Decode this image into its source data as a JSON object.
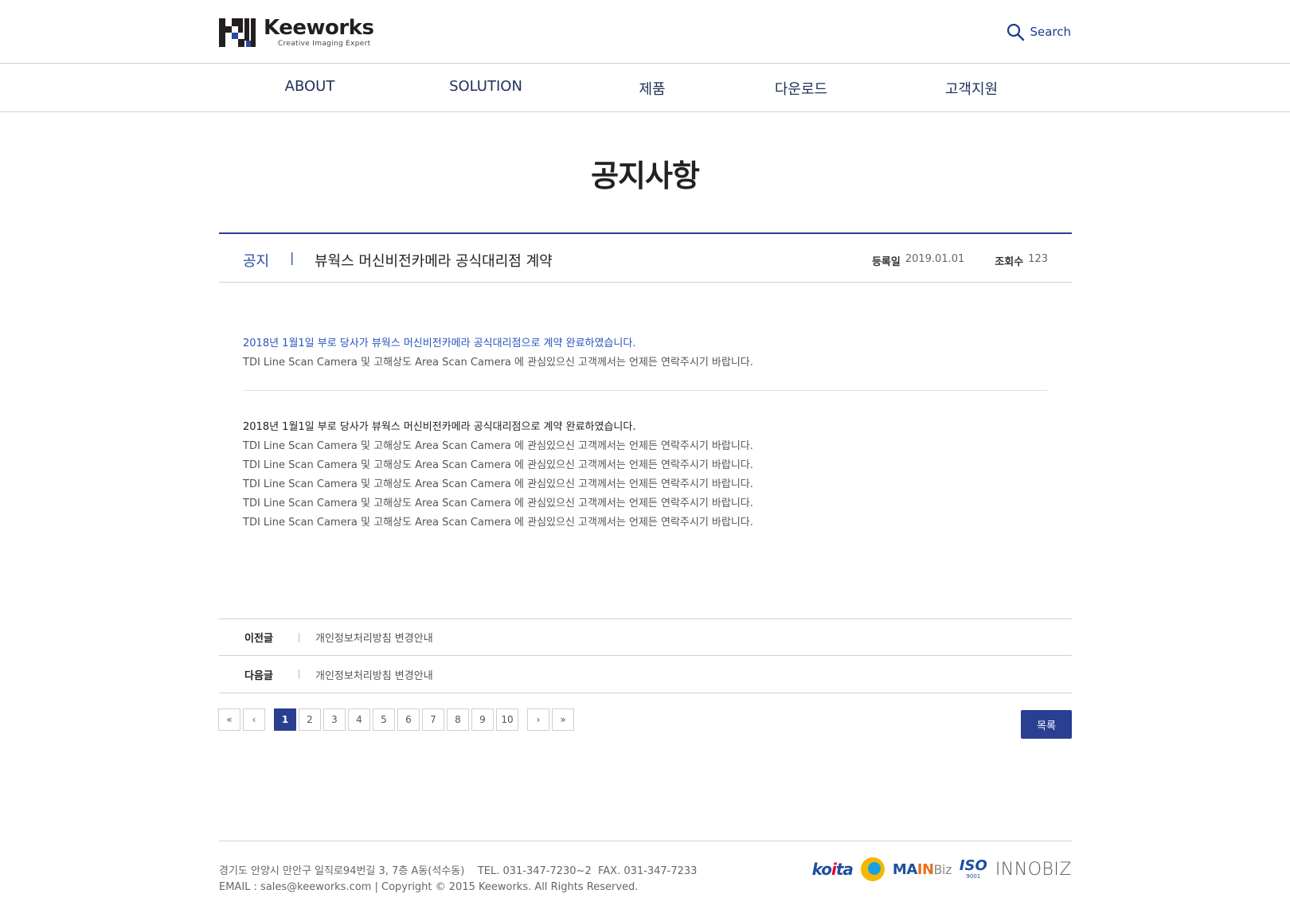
{
  "header": {
    "logo_word": "Keeworks",
    "logo_tagline": "Creative Imaging Expert",
    "search_label": "Search"
  },
  "nav": {
    "items": [
      "ABOUT",
      "SOLUTION",
      "제품",
      "다운로드",
      "고객지원"
    ]
  },
  "page_title": "공지사항",
  "post": {
    "category": "공지",
    "separator": "|",
    "title": "뷰웍스 머신비전카메라 공식대리점 계약",
    "date_label": "등록일",
    "date_value": "2019.01.01",
    "views_label": "조회수",
    "views_value": "123"
  },
  "content": {
    "intro_highlight": "2018년 1월1일 부로 당사가 뷰웍스 머신비전카메라 공식대리점으로 계약 완료하였습니다.",
    "intro_body": "TDI Line Scan Camera 및 고해상도 Area Scan Camera 에 관심있으신 고객께서는 언제든 연락주시기 바랍니다.",
    "section_heading": "2018년 1월1일 부로 당사가 뷰웍스 머신비전카메라 공식대리점으로 계약 완료하였습니다.",
    "section_lines": [
      "TDI Line Scan Camera 및 고해상도 Area Scan Camera 에 관심있으신 고객께서는 언제든 연락주시기 바랍니다.",
      "TDI Line Scan Camera 및 고해상도 Area Scan Camera 에 관심있으신 고객께서는 언제든 연락주시기 바랍니다.",
      "TDI Line Scan Camera 및 고해상도 Area Scan Camera 에 관심있으신 고객께서는 언제든 연락주시기 바랍니다.",
      "TDI Line Scan Camera 및 고해상도 Area Scan Camera 에 관심있으신 고객께서는 언제든 연락주시기 바랍니다.",
      "TDI Line Scan Camera 및 고해상도 Area Scan Camera 에 관심있으신 고객께서는 언제든 연락주시기 바랍니다."
    ]
  },
  "prev_next": {
    "prev_label": "이전글",
    "prev_title": "개인정보처리방침 변경안내",
    "next_label": "다음글",
    "next_title": "개인정보처리방침 변경안내"
  },
  "pagination": {
    "first": "«",
    "prev": "‹",
    "pages": [
      "1",
      "2",
      "3",
      "4",
      "5",
      "6",
      "7",
      "8",
      "9",
      "10"
    ],
    "current": "1",
    "next": "›",
    "last": "»"
  },
  "list_button": "목록",
  "footer": {
    "address_line": "경기도 안양시 만안구 일직로94번길 3, 7층 A동(석수동)    TEL. 031-347-7230~2  FAX. 031-347-7233",
    "copyright_line": "EMAIL : sales@keeworks.com | Copyright © 2015 Keeworks. All Rights Reserved.",
    "cert_iso": "ISO",
    "cert_iso_num": "9001",
    "cert_innobiz": "INNOBIZ"
  },
  "colors": {
    "brand_navy": "#2a3f92",
    "link_blue": "#2a52be",
    "search_blue": "#1b3c8f"
  }
}
